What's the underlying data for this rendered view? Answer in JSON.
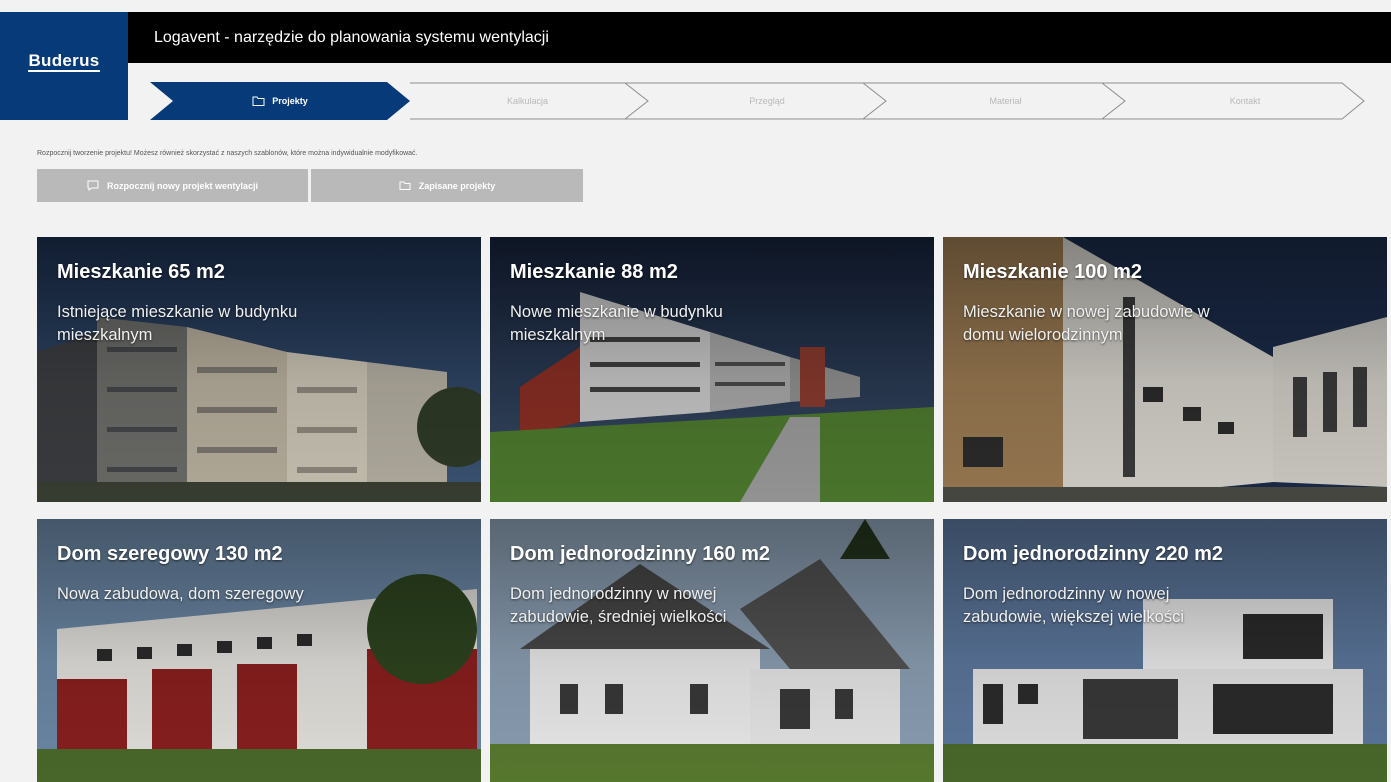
{
  "brand": {
    "logo_text": "Buderus",
    "color": "#063a78"
  },
  "app": {
    "title": "Logavent - narzędzie do planowania systemu wentylacji"
  },
  "steps": [
    {
      "label": "Projekty",
      "active": true,
      "icon": "folder-icon"
    },
    {
      "label": "Kalkulacja",
      "active": false
    },
    {
      "label": "Przegląd",
      "active": false
    },
    {
      "label": "Materiał",
      "active": false
    },
    {
      "label": "Kontakt",
      "active": false
    }
  ],
  "intro": {
    "text": "Rozpocznij tworzenie projektu! Możesz również skorzystać z naszych szablonów, które można indywidualnie modyfikować."
  },
  "buttons": {
    "new_project": "Rozpocznij nowy projekt wentylacji",
    "saved_projects": "Zapisane projekty"
  },
  "cards": [
    {
      "title": "Mieszkanie 65 m2",
      "desc": "Istniejące mieszkanie w budynku mieszkalnym"
    },
    {
      "title": "Mieszkanie 88 m2",
      "desc": "Nowe mieszkanie w budynku mieszkalnym"
    },
    {
      "title": "Mieszkanie 100 m2",
      "desc": "Mieszkanie w nowej zabudowie w domu wielorodzinnym"
    },
    {
      "title": "Dom szeregowy 130 m2",
      "desc": "Nowa zabudowa, dom szeregowy"
    },
    {
      "title": "Dom jednorodzinny 160 m2",
      "desc": "Dom jednorodzinny w nowej zabudowie, średniej wielkości"
    },
    {
      "title": "Dom jednorodzinny 220 m2",
      "desc": "Dom jednorodzinny w nowej zabudowie, większej wielkości"
    }
  ],
  "colors": {
    "active_step": "#063a78",
    "header_bg": "#000000",
    "button_bg": "#b9b9b9",
    "page_bg": "#f2f2f2"
  }
}
